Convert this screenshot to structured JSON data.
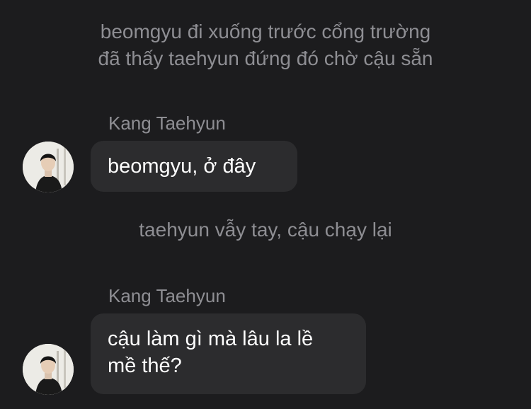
{
  "narration_top": {
    "line1": "beomgyu đi xuống trước cổng trường",
    "line2": "đã thấy taehyun đứng đó chờ cậu sẵn"
  },
  "messages": [
    {
      "sender": "Kang Taehyun",
      "avatar_icon": "profile-photo",
      "text": "beomgyu, ở đây"
    },
    {
      "sender": "Kang Taehyun",
      "avatar_icon": "profile-photo",
      "line1": "cậu làm gì mà lâu la lề",
      "line2": "mề thế?"
    }
  ],
  "narration_middle": "taehyun vẫy tay, cậu chạy lại",
  "colors": {
    "background": "#1c1c1e",
    "bubble": "#2c2c2e",
    "secondary_text": "#8e8e93",
    "primary_text": "#ffffff"
  }
}
